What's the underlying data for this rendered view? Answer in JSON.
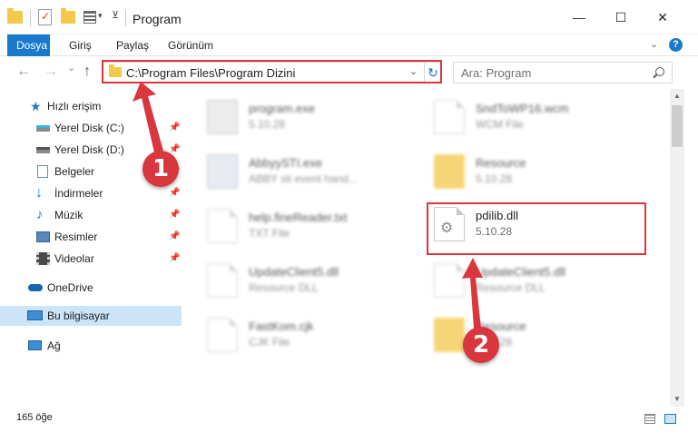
{
  "titlebar": {
    "title": "Program",
    "minimize_glyph": "—",
    "maximize_glyph": "☐",
    "close_glyph": "✕"
  },
  "ribbon": {
    "tabs": [
      {
        "label": "Dosya",
        "active": true
      },
      {
        "label": "Giriş",
        "active": false
      },
      {
        "label": "Paylaş",
        "active": false
      },
      {
        "label": "Görünüm",
        "active": false
      }
    ],
    "help_glyph": "?"
  },
  "nav": {
    "back_glyph": "←",
    "forward_glyph": "→",
    "recent_glyph": "⌄",
    "up_glyph": "↑",
    "address": "C:\\Program Files\\Program Dizini",
    "search_placeholder": "Ara: Program"
  },
  "sidebar": {
    "items": [
      {
        "label": "Hızlı erişim",
        "icon": "star-icon",
        "pinned": false
      },
      {
        "label": "Yerel Disk (C:)",
        "icon": "disk-icon",
        "pinned": true
      },
      {
        "label": "Yerel Disk (D:)",
        "icon": "disk-icon",
        "pinned": true
      },
      {
        "label": "Belgeler",
        "icon": "documents-icon",
        "pinned": true
      },
      {
        "label": "İndirmeler",
        "icon": "download-icon",
        "pinned": true
      },
      {
        "label": "Müzik",
        "icon": "music-icon",
        "pinned": true
      },
      {
        "label": "Resimler",
        "icon": "pictures-icon",
        "pinned": true
      },
      {
        "label": "Videolar",
        "icon": "videos-icon",
        "pinned": true
      },
      {
        "label": "OneDrive",
        "icon": "cloud-icon",
        "pinned": false
      },
      {
        "label": "Bu bilgisayar",
        "icon": "computer-icon",
        "pinned": false,
        "selected": true
      },
      {
        "label": "Ağ",
        "icon": "network-icon",
        "pinned": false
      }
    ]
  },
  "files": [
    {
      "name": "program.exe",
      "meta": "5.10.28",
      "icon": "exe-icon"
    },
    {
      "name": "SndToWP16.wcm",
      "meta": "WCM File",
      "icon": "document-icon"
    },
    {
      "name": "AbbyySTI.exe",
      "meta": "ABBY sti event hand...",
      "icon": "exe-icon"
    },
    {
      "name": "Resource",
      "meta": "5.10.28",
      "icon": "folder-icon"
    },
    {
      "name": "help.fineReader.txt",
      "meta": "TXT File",
      "icon": "document-icon"
    },
    {
      "name": "pdilib.dll",
      "meta": "5.10.28",
      "icon": "dll-gear-icon"
    },
    {
      "name": "UpdateClient5.dll",
      "meta": "Resource DLL",
      "icon": "dll-gear-icon"
    },
    {
      "name": "UpdateClient5.dll",
      "meta": "Resource DLL",
      "icon": "dll-gear-icon"
    },
    {
      "name": "FastKom.cjk",
      "meta": "CJK File",
      "icon": "document-icon"
    },
    {
      "name": "Resource",
      "meta": "5.10.28",
      "icon": "folder-icon"
    }
  ],
  "status": {
    "item_count": "165 öğe"
  },
  "annotations": {
    "step1": "1",
    "step2": "2",
    "color": "#d9363e"
  },
  "colors": {
    "accent": "#1979ca",
    "selection": "#cce4f7",
    "folder": "#f4c84a"
  }
}
